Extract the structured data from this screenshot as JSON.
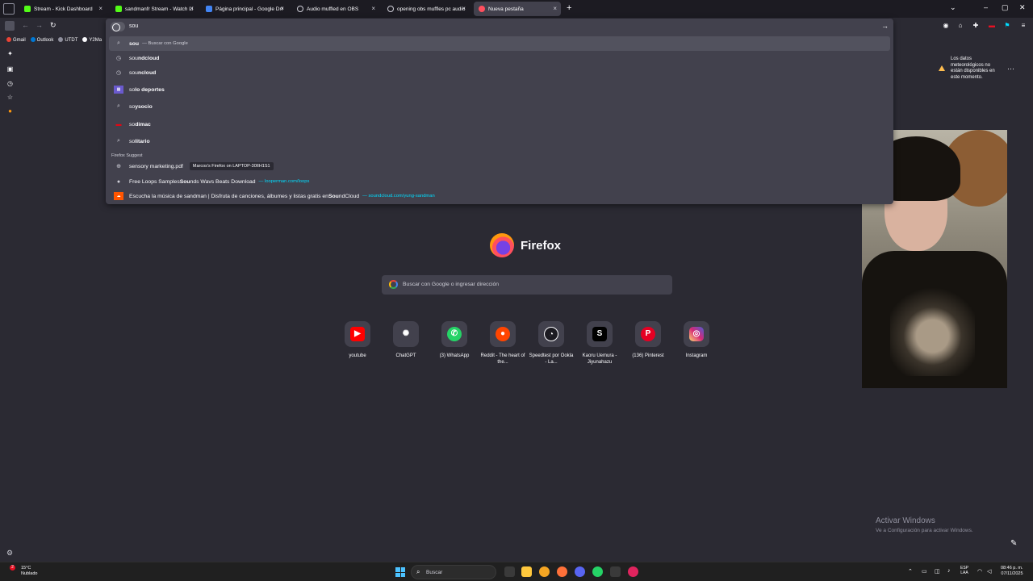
{
  "tabs": [
    {
      "label": "Stream - Kick Dashboard",
      "color": "#53fc18"
    },
    {
      "label": "sandmanfr Stream - Watch Live",
      "color": "#53fc18"
    },
    {
      "label": "Página principal - Google Drive",
      "color": "#4285f4"
    },
    {
      "label": "Audio muffled en OBS",
      "color": "#cfcfd8"
    },
    {
      "label": "opening obs muffles pc audio",
      "color": "#cfcfd8"
    },
    {
      "label": "Nueva pestaña",
      "color": "#ff4f5e"
    }
  ],
  "urlbar": {
    "value": "sou"
  },
  "suggestions": [
    {
      "bold": "sou",
      "rest": "",
      "sub": "— Buscar con Google",
      "icon": "search-icon"
    },
    {
      "bold": "sou",
      "rest": "ndcloud",
      "icon": "history-icon"
    },
    {
      "bold": "sou",
      "rest": "ncloud",
      "icon": "history-icon"
    },
    {
      "bold": "so",
      "rest": "lo deportes",
      "icon": "site-icon"
    },
    {
      "bold": "so",
      "rest": "ysocio",
      "icon": "search-icon"
    },
    {
      "bold": "so",
      "rest": "dimac",
      "icon": "site-icon"
    },
    {
      "bold": "so",
      "rest": "litario",
      "icon": "search-icon"
    }
  ],
  "firefox_suggest_label": "Firefox Suggest",
  "suggest_rows": [
    {
      "pre": "sensory marketing.pdf",
      "badge": "Marcos's Firefox on LAPTOP-30IIH1S1"
    },
    {
      "pre": "Free Loops Samples ",
      "bold": "Sou",
      "post": "nds Wavs Beats Download",
      "link": "— looperman.com/loops"
    },
    {
      "pre": "Escucha la música de sandman | Disfruta de canciones, álbumes y listas gratis en ",
      "bold": "Sou",
      "post": "ndCloud",
      "link": "— soundcloud.com/yung-sandman"
    }
  ],
  "bookmarks": [
    "Gmail",
    "Outlook",
    "UTDT",
    "Y2Ma"
  ],
  "newtab": {
    "brand": "Firefox",
    "search_placeholder": "Buscar con Google o ingresar dirección",
    "shortcuts": [
      {
        "name": "youtube",
        "color": "#ff0000",
        "glyph": "▶"
      },
      {
        "name": "ChatGPT",
        "color": "#42414d",
        "glyph": "✺"
      },
      {
        "name": "(3) WhatsApp",
        "color": "#25d366",
        "glyph": "✆"
      },
      {
        "name": "Reddit - The heart of the...",
        "color": "#ff4500",
        "glyph": "●"
      },
      {
        "name": "Speedtest por Ookla - La...",
        "color": "#1c1b22",
        "glyph": "◔"
      },
      {
        "name": "Kaoru Uemura - Jiyunahazu",
        "color": "#000000",
        "glyph": "S"
      },
      {
        "name": "(136) Pinterest",
        "color": "#e60023",
        "glyph": "P"
      },
      {
        "name": "Instagram",
        "color": "#d6249f",
        "glyph": "◎"
      }
    ]
  },
  "weather": {
    "message": "Los datos meteorológicos no están disponibles en este momento."
  },
  "activate": {
    "title": "Activar Windows",
    "subtitle": "Ve a Configuración para activar Windows."
  },
  "taskbar": {
    "weather_temp": "15°C",
    "weather_desc": "Nublado",
    "weather_badge": "2",
    "search_label": "Buscar",
    "lang_top": "ESP",
    "lang_bottom": "LAA",
    "time": "08:46 p. m.",
    "date": "07/11/2025"
  }
}
